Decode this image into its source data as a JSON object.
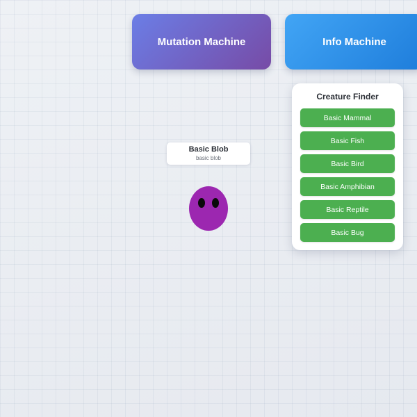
{
  "machines": {
    "mutation": {
      "label": "Mutation Machine"
    },
    "info": {
      "label": "Info Machine"
    }
  },
  "creature_finder": {
    "title": "Creature Finder",
    "buttons": [
      "Basic Mammal",
      "Basic Fish",
      "Basic Bird",
      "Basic Amphibian",
      "Basic Reptile",
      "Basic Bug"
    ]
  },
  "creature": {
    "name": "Basic Blob",
    "subtitle": "basic blob",
    "color": "#9c27b0",
    "eye_color": "#0a0a0a"
  },
  "colors": {
    "finder_button": "#4caf50",
    "mutation_gradient": [
      "#6b7ee6",
      "#774ba6"
    ],
    "info_gradient": [
      "#42a5f5",
      "#1e7ddb"
    ]
  }
}
